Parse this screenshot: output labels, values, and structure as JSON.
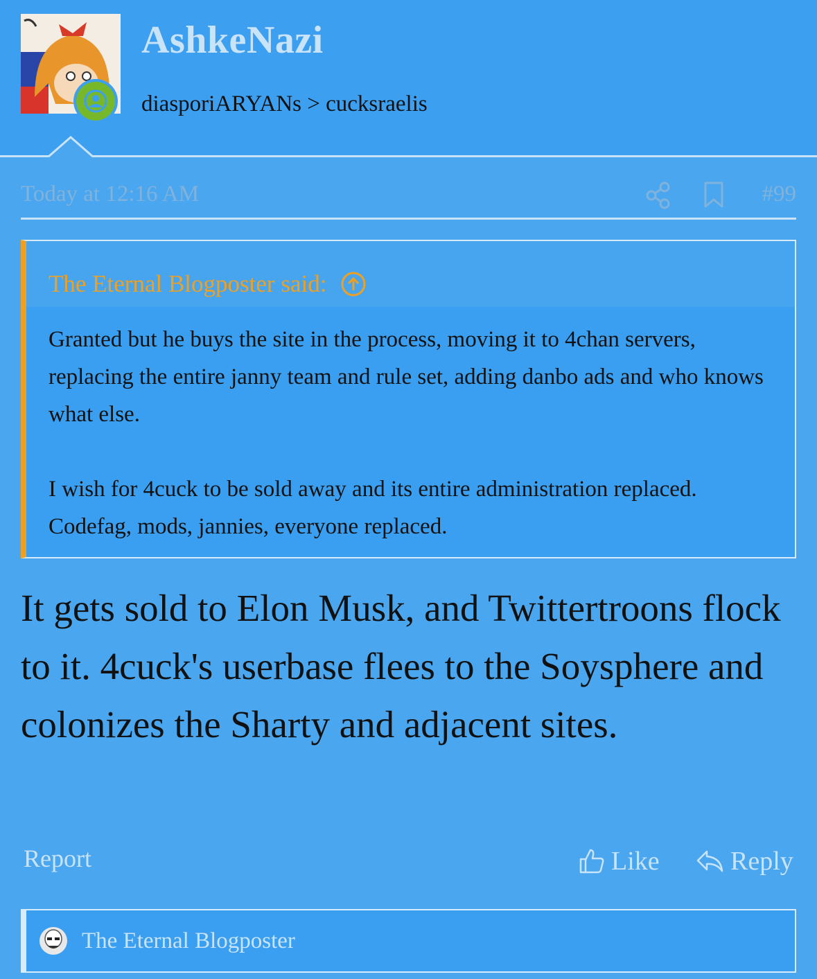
{
  "user": {
    "name": "AshkeNazi",
    "title": "diasporiARYANs > cucksraelis"
  },
  "post": {
    "date": "Today at 12:16 AM",
    "number": "#99",
    "quote": {
      "author": "The Eternal Blogposter said:",
      "paragraphs": [
        "Granted but he buys the site in the process, moving it to 4chan servers, replacing the entire janny team and rule set, adding danbo ads and who knows what else.",
        "I wish for 4cuck to be sold away and its entire administration replaced. Codefag, mods, jannies, everyone replaced."
      ]
    },
    "message": "It gets sold to Elon Musk, and Twittertroons flock to it. 4cuck's userbase flees to the Soysphere and colonizes the Sharty and adjacent sites."
  },
  "actions": {
    "report": "Report",
    "like": "Like",
    "reply": "Reply"
  },
  "reactions": {
    "user": "The Eternal Blogposter"
  },
  "icons": {
    "share": "share-icon",
    "bookmark": "bookmark-icon",
    "quote_jump": "arrow-up-circle-icon",
    "like": "thumbs-up-icon",
    "reply": "reply-arrow-icon",
    "online": "user-online-icon"
  },
  "colors": {
    "background": "#4aa6ee",
    "header": "#3d9ff0",
    "accent_orange": "#f0a020",
    "muted_text": "#7fb3dd",
    "light_text": "#c9e3f8",
    "online_green": "#76b82a"
  }
}
